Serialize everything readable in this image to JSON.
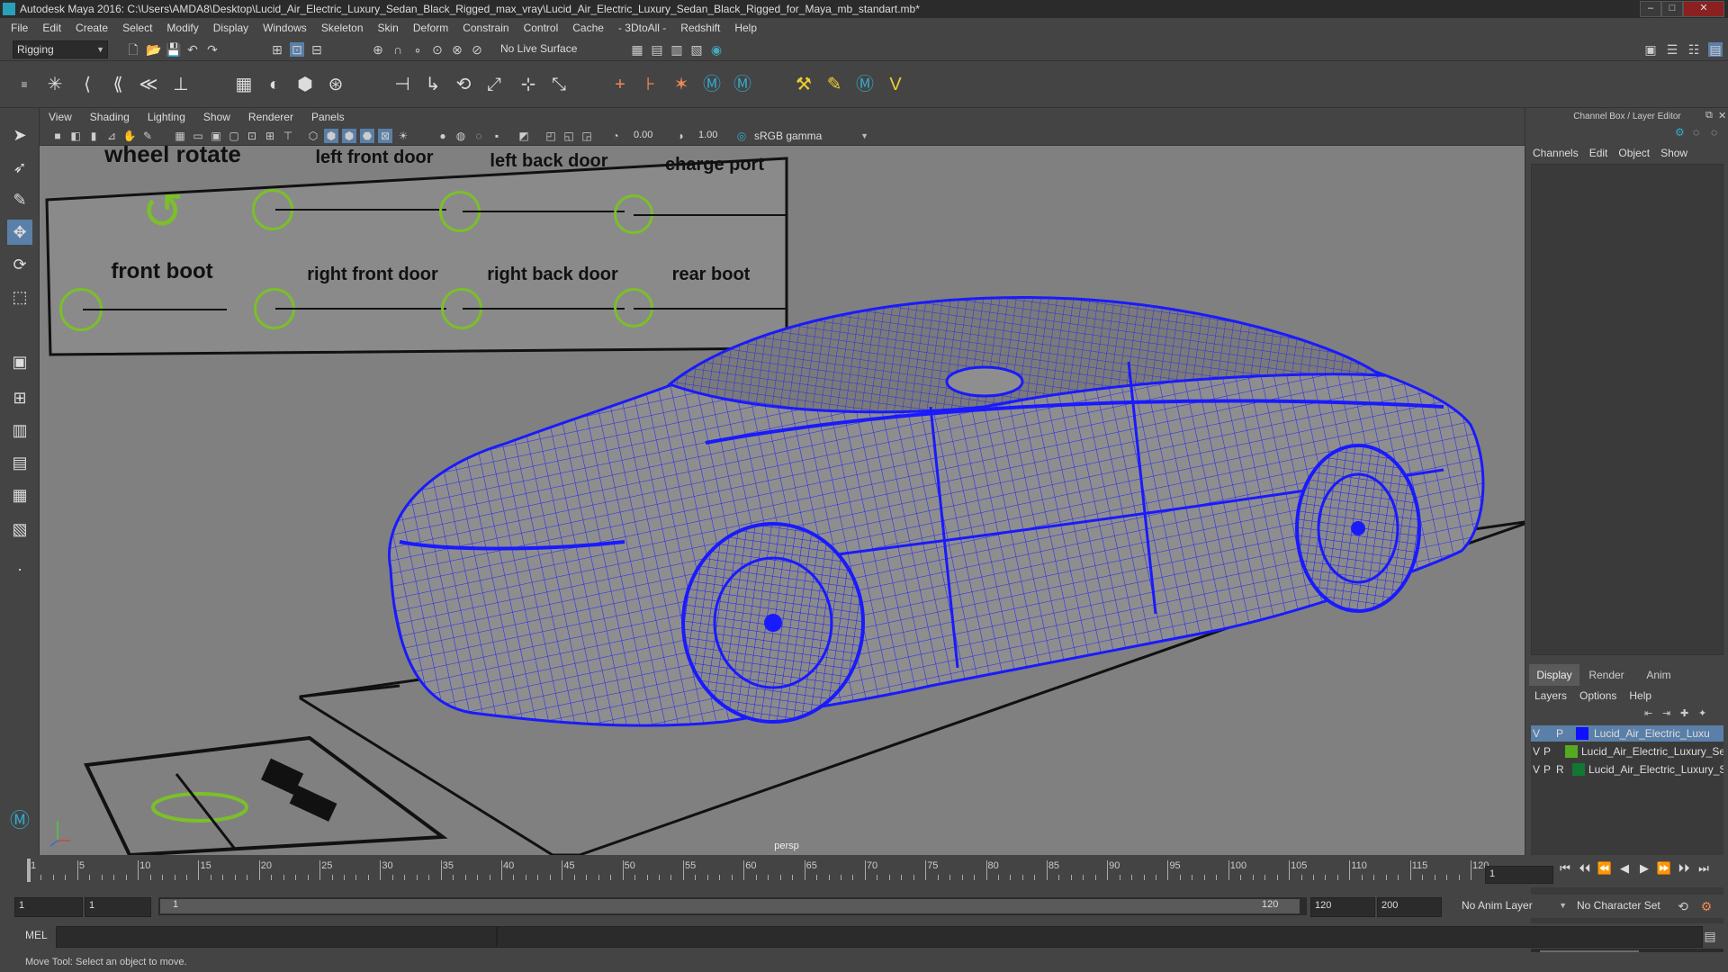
{
  "window": {
    "title": "Autodesk Maya 2016: C:\\Users\\AMDA8\\Desktop\\Lucid_Air_Electric_Luxury_Sedan_Black_Rigged_max_vray\\Lucid_Air_Electric_Luxury_Sedan_Black_Rigged_for_Maya_mb_standart.mb*",
    "controls": [
      "minimize-icon",
      "maximize-icon",
      "close-icon"
    ]
  },
  "menubar": [
    "File",
    "Edit",
    "Create",
    "Select",
    "Modify",
    "Display",
    "Windows",
    "Skeleton",
    "Skin",
    "Deform",
    "Constrain",
    "Control",
    "Cache",
    "- 3DtoAll -",
    "Redshift",
    "Help"
  ],
  "statusline": {
    "menuset": "Rigging",
    "live_surface": "No Live Surface"
  },
  "viewport": {
    "menu": [
      "View",
      "Shading",
      "Lighting",
      "Show",
      "Renderer",
      "Panels"
    ],
    "near_value": "0.00",
    "far_value": "1.00",
    "colorspace": "sRGB gamma",
    "camera_label": "persp",
    "controls_panel": {
      "row1": [
        "wheel rotate",
        "left front door",
        "left back door",
        "charge port"
      ],
      "row2": [
        "front boot",
        "right front door",
        "right back door",
        "rear boot"
      ]
    }
  },
  "channel_box": {
    "header": "Channel Box / Layer Editor",
    "menu": [
      "Channels",
      "Edit",
      "Object",
      "Show"
    ]
  },
  "layer_editor": {
    "tabs": [
      "Display",
      "Render",
      "Anim"
    ],
    "menu": [
      "Layers",
      "Options",
      "Help"
    ],
    "layers": [
      {
        "v": "V",
        "p": "P",
        "r": "",
        "name": "Lucid_Air_Electric_Luxu",
        "color": "#1010ff",
        "selected": true
      },
      {
        "v": "V",
        "p": "P",
        "r": "",
        "name": "Lucid_Air_Electric_Luxury_Sec",
        "color": "#55aa22",
        "selected": false
      },
      {
        "v": "V",
        "p": "P",
        "r": "R",
        "name": "Lucid_Air_Electric_Luxury_S",
        "color": "#117733",
        "selected": false
      }
    ]
  },
  "timeline": {
    "ticks": [
      "1",
      "5",
      "10",
      "15",
      "20",
      "25",
      "30",
      "35",
      "40",
      "45",
      "50",
      "55",
      "60",
      "65",
      "70",
      "75",
      "80",
      "85",
      "90",
      "95",
      "100",
      "105",
      "110",
      "115",
      "120"
    ],
    "current_frame": "1",
    "range_start": "1",
    "range_start_inner": "1",
    "slider_start": "1",
    "slider_end": "120",
    "range_end_inner": "120",
    "range_end": "200",
    "anim_layer": "No Anim Layer",
    "character_set": "No Character Set"
  },
  "command_line": {
    "language": "MEL"
  },
  "help_line": "Move Tool: Select an object to move.",
  "colors": {
    "wire": "#1a1aff",
    "control_green": "#7bbf2a",
    "ui_bg": "#444444"
  }
}
